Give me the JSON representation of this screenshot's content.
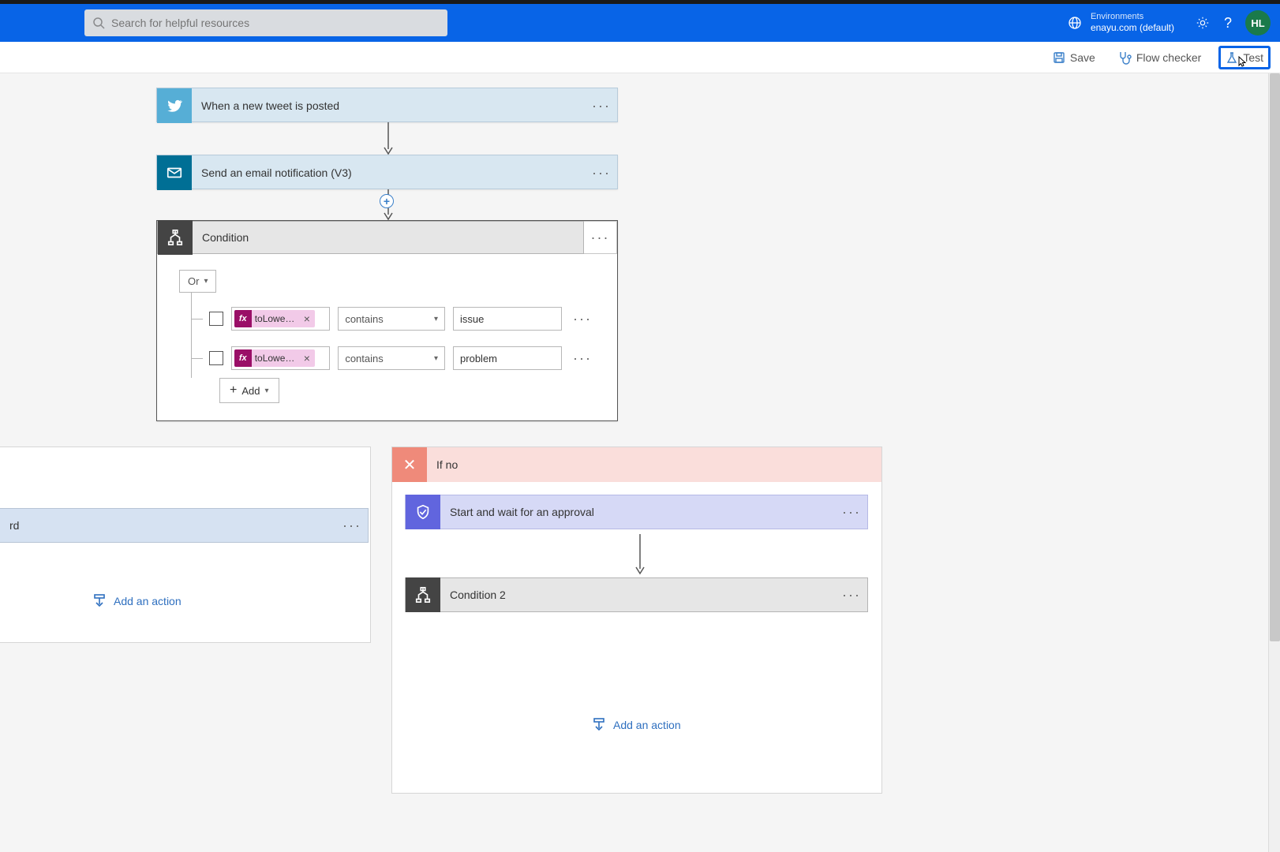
{
  "topbar": {
    "search_placeholder": "Search for helpful resources",
    "env_label": "Environments",
    "env_name": "enayu.com (default)",
    "avatar": "HL"
  },
  "actionbar": {
    "save": "Save",
    "flow_checker": "Flow checker",
    "test": "Test"
  },
  "flow": {
    "trigger": {
      "title": "When a new tweet is posted"
    },
    "mail": {
      "title": "Send an email notification (V3)"
    },
    "condition": {
      "title": "Condition",
      "operator": "Or",
      "add_label": "Add",
      "rows": [
        {
          "expr": "toLower(...",
          "op": "contains",
          "value": "issue"
        },
        {
          "expr": "toLower(...",
          "op": "contains",
          "value": "problem"
        }
      ]
    },
    "if_yes": {
      "title_partial": "rd",
      "add_action": "Add an action"
    },
    "if_no": {
      "title": "If no",
      "approval": "Start and wait for an approval",
      "cond2": "Condition 2",
      "add_action": "Add an action"
    }
  }
}
